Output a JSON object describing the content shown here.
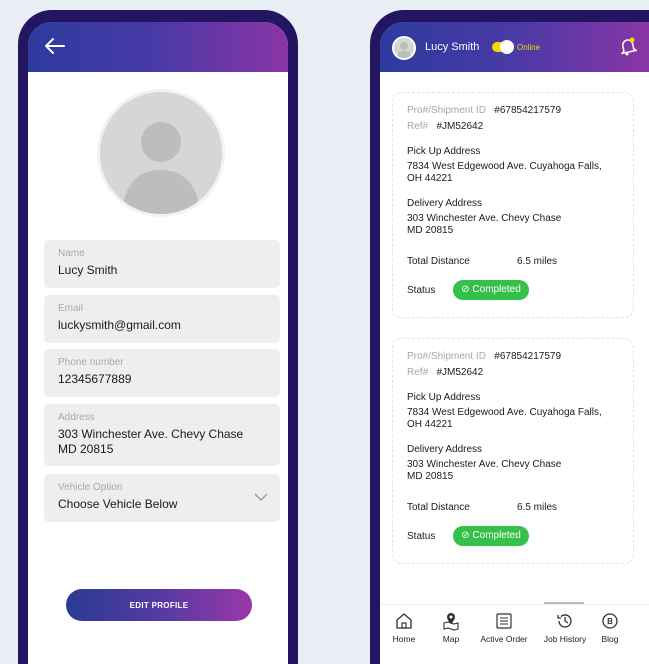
{
  "profile": {
    "fields": {
      "name": {
        "label": "Name",
        "value": "Lucy Smith"
      },
      "email": {
        "label": "Email",
        "value": "luckysmith@gmail.com"
      },
      "phone": {
        "label": "Phone number",
        "value": "12345677889"
      },
      "address": {
        "label": "Address",
        "value": "303 Winchester Ave. Chevy Chase\nMD 20815"
      },
      "vehicle": {
        "label": "Vehicle Option",
        "value": "Choose Vehicle Below"
      }
    },
    "edit_button": "EDIT PROFILE"
  },
  "jobs": {
    "header": {
      "user_name": "Lucy Smith",
      "status": "Online"
    },
    "cards": [
      {
        "shipment_label": "Pro#/Shipment ID",
        "shipment_id": "#67854217579",
        "ref_label": "Ref#",
        "ref_id": "#JM52642",
        "pickup_label": "Pick Up Address",
        "pickup_address": "7834 West Edgewood Ave. Cuyahoga Falls,\nOH 44221",
        "delivery_label": "Delivery Address",
        "delivery_address": "303 Winchester Ave. Chevy Chase\nMD 20815",
        "distance_label": "Total Distance",
        "distance_value": "6.5 miles",
        "status_label": "Status",
        "status_value": "Completed"
      },
      {
        "shipment_label": "Pro#/Shipment ID",
        "shipment_id": "#67854217579",
        "ref_label": "Ref#",
        "ref_id": "#JM52642",
        "pickup_label": "Pick Up Address",
        "pickup_address": "7834 West Edgewood Ave. Cuyahoga Falls,\nOH 44221",
        "delivery_label": "Delivery Address",
        "delivery_address": "303 Winchester Ave. Chevy Chase\nMD 20815",
        "distance_label": "Total Distance",
        "distance_value": "6.5 miles",
        "status_label": "Status",
        "status_value": "Completed"
      }
    ],
    "nav": [
      {
        "label": "Home",
        "icon": "home-icon"
      },
      {
        "label": "Map",
        "icon": "map-icon"
      },
      {
        "label": "Active Order",
        "icon": "list-icon"
      },
      {
        "label": "Job History",
        "icon": "history-icon"
      },
      {
        "label": "Blog",
        "icon": "blog-icon"
      }
    ]
  },
  "colors": {
    "header_gradient_start": "#2d3a9e",
    "header_gradient_end": "#8a35a6",
    "phone_frame": "#23155f",
    "status_completed": "#35c04a",
    "online_indicator": "#f4d800"
  }
}
